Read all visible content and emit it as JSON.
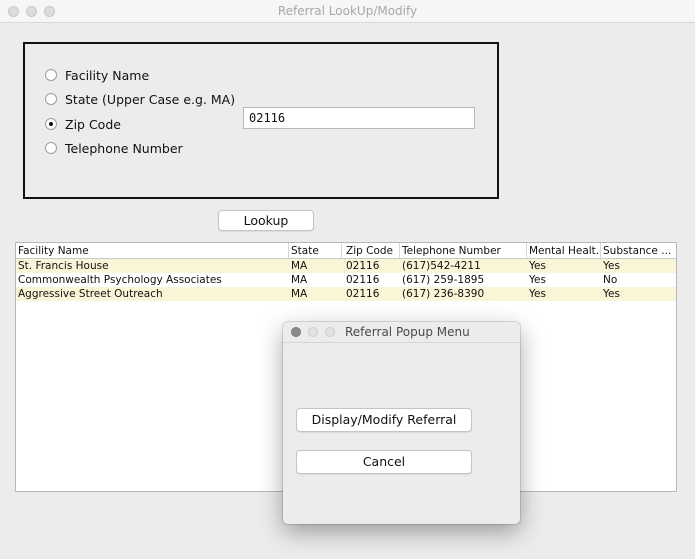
{
  "window": {
    "title": "Referral LookUp/Modify"
  },
  "search": {
    "options": [
      {
        "label": "Facility Name",
        "checked": false
      },
      {
        "label": "State (Upper Case e.g. MA)",
        "checked": false
      },
      {
        "label": "Zip Code",
        "checked": true
      },
      {
        "label": "Telephone Number",
        "checked": false
      }
    ],
    "value": "02116",
    "lookup_label": "Lookup"
  },
  "table": {
    "columns": [
      "Facility Name",
      "State",
      "Zip Code",
      "Telephone Number",
      "Mental Healt...",
      "Substance ..."
    ],
    "rows": [
      [
        "St. Francis House",
        "MA",
        "02116",
        "(617)542-4211",
        "Yes",
        "Yes"
      ],
      [
        "Commonwealth Psychology Associates",
        "MA",
        "02116",
        "(617) 259-1895",
        "Yes",
        "No"
      ],
      [
        "Aggressive Street Outreach",
        "MA",
        "02116",
        "(617) 236-8390",
        "Yes",
        "Yes"
      ]
    ]
  },
  "popup": {
    "title": "Referral Popup Menu",
    "display_label": "Display/Modify Referral",
    "cancel_label": "Cancel"
  }
}
